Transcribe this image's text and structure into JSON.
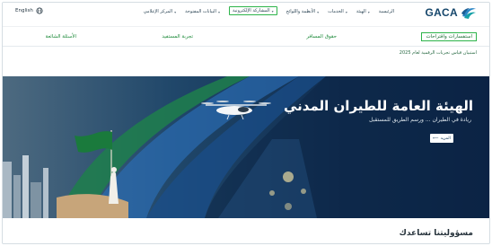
{
  "header": {
    "language": "English",
    "logo_text": "GACA",
    "nav": [
      {
        "label": "الرئيسية",
        "active": false,
        "chevron": false
      },
      {
        "label": "الهيئة",
        "active": false,
        "chevron": true
      },
      {
        "label": "الخدمات",
        "active": false,
        "chevron": true
      },
      {
        "label": "الأنظمة واللوائح",
        "active": false,
        "chevron": true
      },
      {
        "label": "المشاركة الإلكترونية",
        "active": true,
        "chevron": true
      },
      {
        "label": "البيانات المفتوحة",
        "active": false,
        "chevron": true
      },
      {
        "label": "المركز الإعلامي",
        "active": false,
        "chevron": true
      }
    ]
  },
  "feedback": {
    "tabs": [
      {
        "label": "استفسارات واقتراحات",
        "selected": true
      },
      {
        "label": "حقوق المسافر",
        "selected": false
      },
      {
        "label": "تجربة المستفيد",
        "selected": false
      },
      {
        "label": "الأسئلة الشائعة",
        "selected": false
      }
    ],
    "subtext": "استبيان قياس تجربات الرقمية لعام 2025"
  },
  "hero": {
    "title": "الهيئة العامة للطيران المدني",
    "subtitle": "ريادة في الطيران ... ورسم الطريق للمستقبل",
    "button_label": "المزيد",
    "button_arrow": "⟵"
  },
  "section": {
    "title": "مسؤوليتنا تساعدك"
  },
  "colors": {
    "accent_green": "#2db44a",
    "brand_blue": "#15466b",
    "hero_dark": "#0b2142"
  },
  "icons": {
    "language": "globe-icon",
    "logo": "gaca-logo-icon",
    "nav_dropdown": "chevron-down-icon",
    "button_arrow": "arrow-left-icon"
  }
}
